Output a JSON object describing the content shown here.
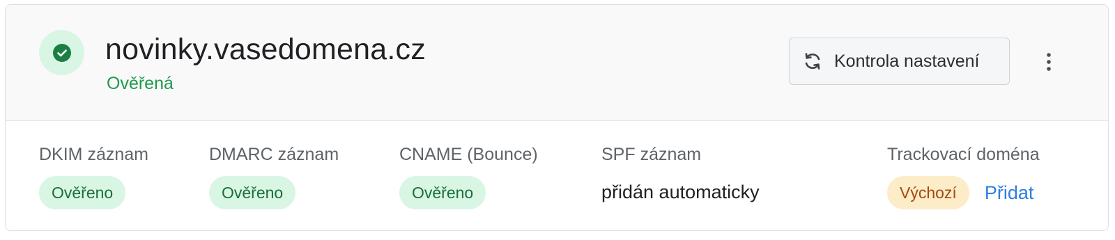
{
  "domain": {
    "name": "novinky.vasedomena.cz",
    "status": "Ověřená",
    "status_icon": "check-circle-icon",
    "status_color": "#1f9a4f"
  },
  "actions": {
    "check_label": "Kontrola nastavení",
    "check_icon": "refresh-icon",
    "more_icon": "kebab-menu-icon"
  },
  "records": [
    {
      "label": "DKIM záznam",
      "value": "Ověřeno",
      "kind": "badge-ok"
    },
    {
      "label": "DMARC záznam",
      "value": "Ověřeno",
      "kind": "badge-ok"
    },
    {
      "label": "CNAME (Bounce)",
      "value": "Ověřeno",
      "kind": "badge-ok"
    },
    {
      "label": "SPF záznam",
      "value": "přidán automaticky",
      "kind": "text"
    },
    {
      "label": "Trackovací doména",
      "value": "Výchozí",
      "kind": "badge-default",
      "link": "Přidat"
    }
  ],
  "colors": {
    "ok_badge_bg": "#d9f6e4",
    "ok_badge_text": "#1b6e3c",
    "default_badge_bg": "#fdecc8",
    "default_badge_text": "#a14a10",
    "link": "#2f7de1"
  }
}
